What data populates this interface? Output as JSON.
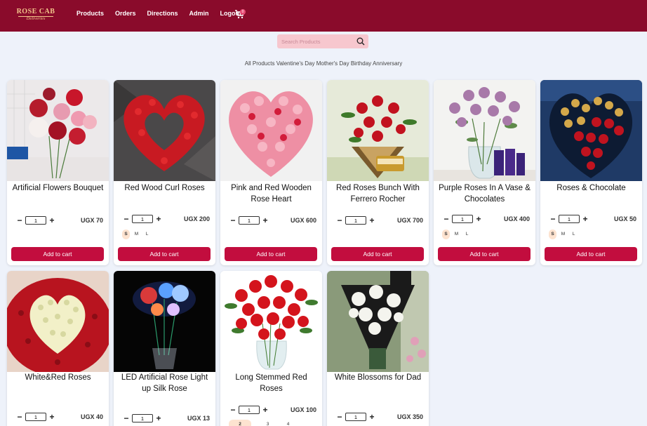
{
  "brand": {
    "logo_top": "ROSE CAB",
    "logo_bottom": "Deliveries"
  },
  "nav": {
    "items": [
      "Products",
      "Orders",
      "Directions",
      "Admin",
      "Logout"
    ],
    "cart_count": "0"
  },
  "search": {
    "placeholder": "Search Products",
    "value": ""
  },
  "categories": [
    "All Products",
    "Valentine's Day",
    "Mother's Day",
    "Birthday",
    "Anniversary"
  ],
  "add_to_cart_label": "Add to cart",
  "colors": {
    "navbar": "#8a0b2b",
    "accent": "#c20d3e",
    "background": "#eef2fa",
    "search": "#f7c7ce"
  },
  "products": [
    {
      "title": "Artificial Flowers Bouquet",
      "price": "UGX 70",
      "qty": "1",
      "sizes": [],
      "image": "artificial-flowers-image"
    },
    {
      "title": "Red Wood Curl Roses",
      "price": "UGX 200",
      "qty": "1",
      "sizes": [
        "S",
        "M",
        "L"
      ],
      "active_size": "S",
      "image": "red-wood-curl-roses-image"
    },
    {
      "title": "Pink and Red Wooden Rose Heart",
      "price": "UGX 600",
      "qty": "1",
      "sizes": [],
      "image": "pink-red-rose-heart-image"
    },
    {
      "title": "Red Roses Bunch With Ferrero Rocher",
      "price": "UGX 700",
      "qty": "1",
      "sizes": [],
      "image": "red-roses-ferrero-image"
    },
    {
      "title": "Purple Roses In A Vase & Chocolates",
      "price": "UGX 400",
      "qty": "1",
      "sizes": [
        "S",
        "M",
        "L"
      ],
      "active_size": "S",
      "image": "purple-roses-vase-image"
    },
    {
      "title": "Roses & Chocolate",
      "price": "UGX 50",
      "qty": "1",
      "sizes": [
        "S",
        "M",
        "L"
      ],
      "active_size": "S",
      "image": "roses-chocolate-image"
    },
    {
      "title": "White&Red Roses",
      "price": "UGX 40",
      "qty": "1",
      "sizes": [],
      "image": "white-red-roses-image"
    },
    {
      "title": "LED Artificial Rose Light up Silk Rose",
      "price": "UGX 13",
      "qty": "1",
      "sizes": [],
      "image": "led-rose-image"
    },
    {
      "title": "Long Stemmed Red Roses",
      "price": "UGX 100",
      "qty": "1",
      "sizes": [
        "2",
        "3",
        "4"
      ],
      "active_size": "2",
      "image": "long-stemmed-roses-image"
    },
    {
      "title": "White Blossoms for Dad",
      "price": "UGX 350",
      "qty": "1",
      "sizes": [],
      "image": "white-blossoms-image"
    }
  ]
}
